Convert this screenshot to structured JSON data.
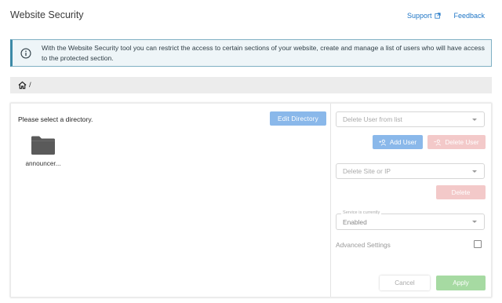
{
  "header": {
    "title": "Website Security",
    "support_label": "Support",
    "feedback_label": "Feedback"
  },
  "info": {
    "text": "With the Website Security tool you can restrict the access to certain sections of your website, create and manage a list of users who will have access to the protected section."
  },
  "breadcrumb": {
    "separator": "/"
  },
  "directory": {
    "prompt": "Please select a directory.",
    "edit_label": "Edit Directory",
    "folders": [
      {
        "name": "announcer..."
      }
    ]
  },
  "users": {
    "select_placeholder": "Delete User from list",
    "add_label": "Add User",
    "delete_label": "Delete User"
  },
  "sites": {
    "select_placeholder": "Delete Site or IP",
    "delete_label": "Delete"
  },
  "service": {
    "legend": "Service is currently",
    "value": "Enabled"
  },
  "advanced": {
    "label": "Advanced Settings",
    "checked": false
  },
  "footer": {
    "cancel_label": "Cancel",
    "apply_label": "Apply"
  },
  "colors": {
    "link": "#1f76c6",
    "primary": "#8ab8ea",
    "danger_disabled": "#f3c9c9",
    "success_disabled": "#a6daa2",
    "info_border": "#3d8aa7"
  }
}
